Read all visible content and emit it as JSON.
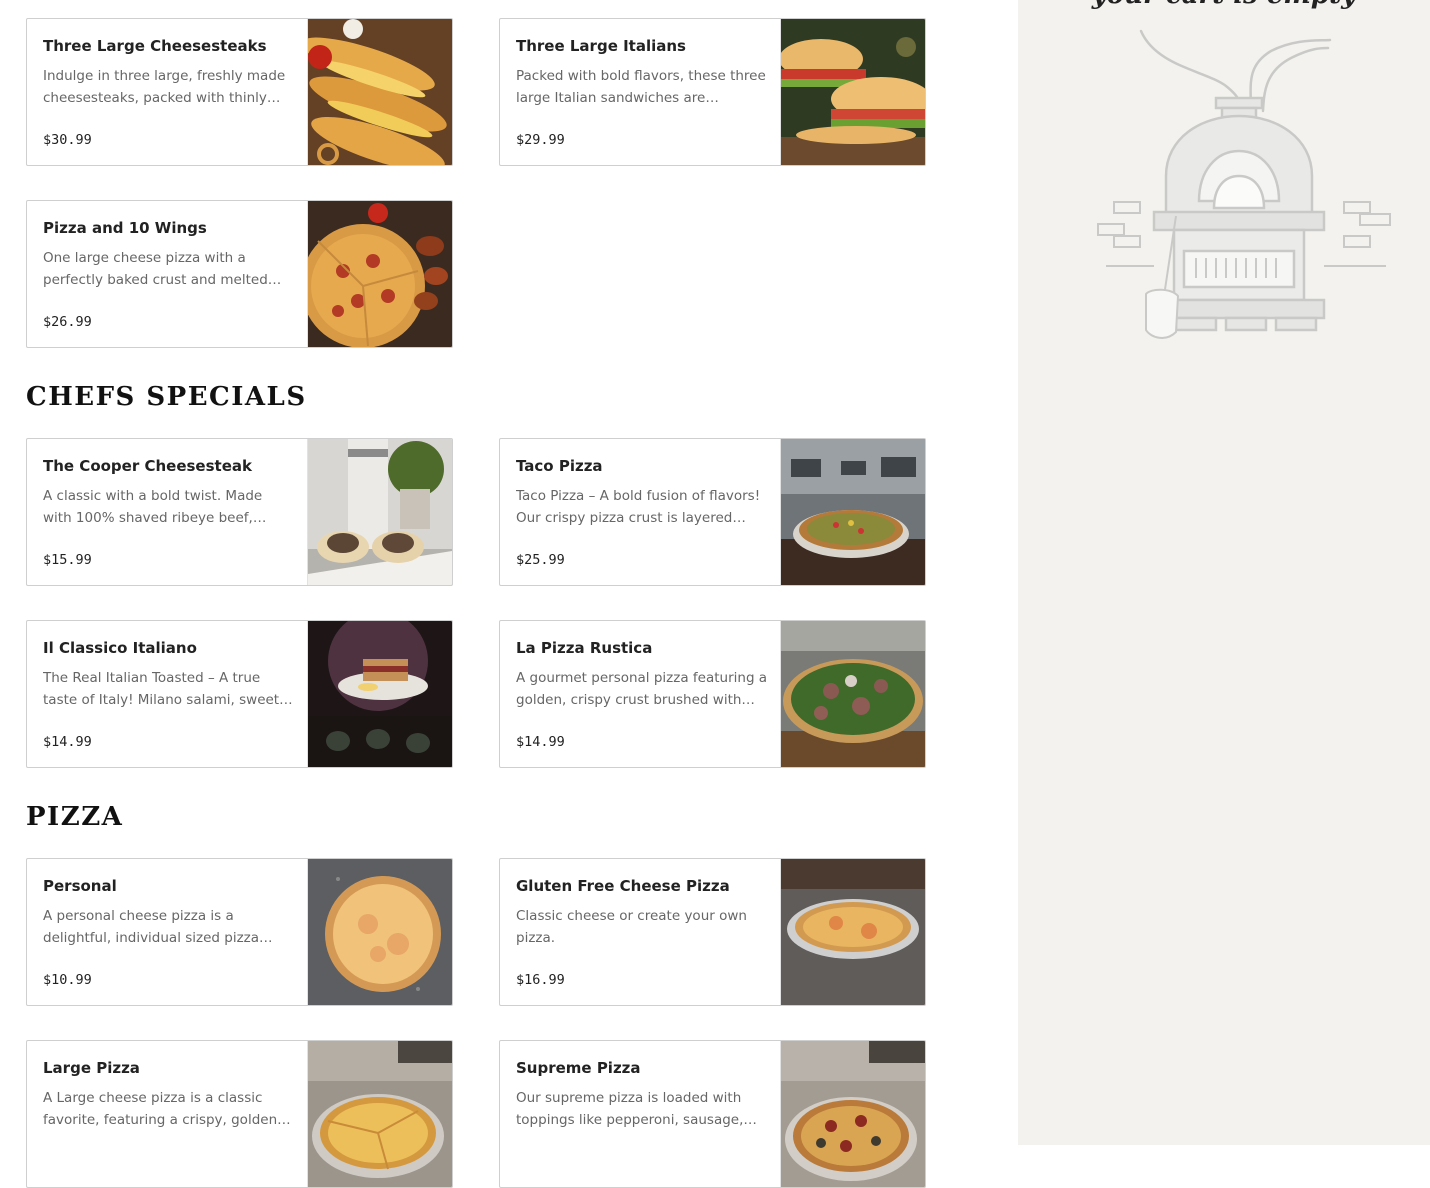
{
  "cart": {
    "empty_text": "your cart is empty"
  },
  "sections": [
    {
      "items": [
        {
          "name": "Three Large Cheesesteaks",
          "description": "Indulge in three large, freshly made cheesesteaks, packed with thinly…",
          "price": "$30.99",
          "image": "cheesesteaks"
        },
        {
          "name": "Three Large Italians",
          "description": "Packed with bold flavors, these three large Italian sandwiches are stacked…",
          "price": "$29.99",
          "image": "italian-subs"
        },
        {
          "name": "Pizza and 10 Wings",
          "description": "One large cheese pizza with a perfectly baked crust and melted cheese. Ten…",
          "price": "$26.99",
          "image": "pizza-wings"
        }
      ]
    },
    {
      "title": "CHEFS SPECIALS",
      "items": [
        {
          "name": "The Cooper Cheesesteak",
          "description": "A classic with a bold twist. Made with 100% shaved ribeye beef, seared to…",
          "price": "$15.99",
          "image": "cooper-cheesesteak"
        },
        {
          "name": "Taco Pizza",
          "description": "Taco Pizza – A bold fusion of flavors! Our crispy pizza crust is layered with…",
          "price": "$25.99",
          "image": "taco-pizza"
        },
        {
          "name": "Il Classico Italiano",
          "description": "The Real Italian Toasted – A true taste of Italy! Milano salami, sweet…",
          "price": "$14.99",
          "image": "classico-italiano"
        },
        {
          "name": "La Pizza Rustica",
          "description": "A gourmet personal pizza featuring a golden, crispy crust brushed with oliv…",
          "price": "$14.99",
          "image": "pizza-rustica"
        }
      ]
    },
    {
      "title": "PIZZA",
      "items": [
        {
          "name": "Personal",
          "description": "A personal cheese pizza is a delightful, individual sized pizza featuring a…",
          "price": "$10.99",
          "image": "personal-pizza"
        },
        {
          "name": "Gluten Free Cheese Pizza",
          "description": "Classic cheese or create your own pizza.",
          "price": "$16.99",
          "image": "gluten-free-pizza"
        },
        {
          "name": "Large Pizza",
          "description": "A Large cheese pizza is a classic favorite, featuring a crispy, golden cru…",
          "price": "",
          "image": "large-pizza"
        },
        {
          "name": "Supreme Pizza",
          "description": "Our supreme pizza is loaded with toppings like pepperoni, sausage,…",
          "price": "",
          "image": "supreme-pizza"
        }
      ]
    }
  ]
}
